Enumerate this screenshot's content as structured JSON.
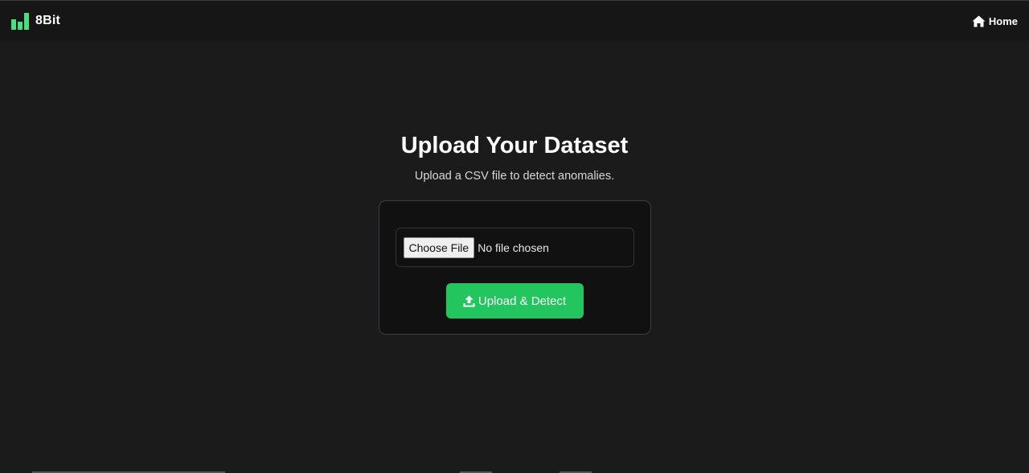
{
  "navbar": {
    "brand_name": "8Bit",
    "brand_color": "#4ade80",
    "home_label": "Home",
    "home_icon": "home-icon"
  },
  "main": {
    "title": "Upload Your Dataset",
    "subtitle": "Upload a CSV file to detect anomalies."
  },
  "upload_form": {
    "choose_file_label": "Choose File",
    "file_status": "No file chosen",
    "submit_label": "Upload & Detect",
    "submit_icon": "upload-icon",
    "submit_color": "#22c55e"
  }
}
